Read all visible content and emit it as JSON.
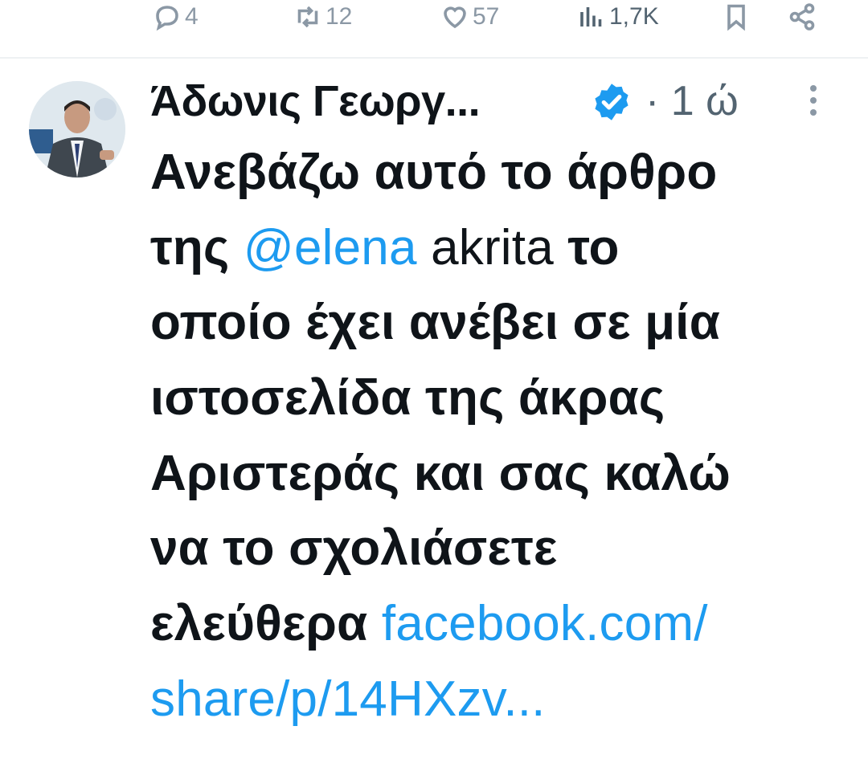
{
  "prev_actions": {
    "reply_count": "4",
    "retweet_count": "12",
    "like_count": "57",
    "views_count": "1,7K",
    "icons": [
      "reply-icon",
      "retweet-icon",
      "heart-icon",
      "views-icon",
      "bookmark-icon",
      "share-icon"
    ]
  },
  "tweet": {
    "author_name": "Άδωνις Γεωργ...",
    "verified": true,
    "time_separator": "·",
    "time": "1 ώ",
    "text_lines": [
      {
        "parts": [
          {
            "t": "Ανεβάζω αυτό το άρθρο",
            "style": "bold"
          }
        ]
      },
      {
        "parts": [
          {
            "t": "της ",
            "style": "bold"
          },
          {
            "t": "@elena",
            "style": "link"
          },
          {
            "t": " akrita",
            "style": "plain"
          },
          {
            "t": " το",
            "style": "bold"
          }
        ]
      },
      {
        "parts": [
          {
            "t": "οποίο έχει ανέβει σε μία",
            "style": "bold"
          }
        ]
      },
      {
        "parts": [
          {
            "t": "ιστοσελίδα της άκρας",
            "style": "bold"
          }
        ]
      },
      {
        "parts": [
          {
            "t": "Αριστεράς και σας καλώ",
            "style": "bold"
          }
        ]
      },
      {
        "parts": [
          {
            "t": "να το σχολιάσετε",
            "style": "bold"
          }
        ]
      },
      {
        "parts": [
          {
            "t": "ελεύθερα ",
            "style": "bold"
          },
          {
            "t": "facebook.com/",
            "style": "link"
          }
        ]
      },
      {
        "parts": [
          {
            "t": "share/p/14HXzv...",
            "style": "link"
          }
        ]
      }
    ]
  },
  "colors": {
    "link": "#1d9bf0",
    "muted": "#536471",
    "icon": "#8b98a5",
    "verified": "#1d9bf0",
    "text": "#0f1419"
  }
}
